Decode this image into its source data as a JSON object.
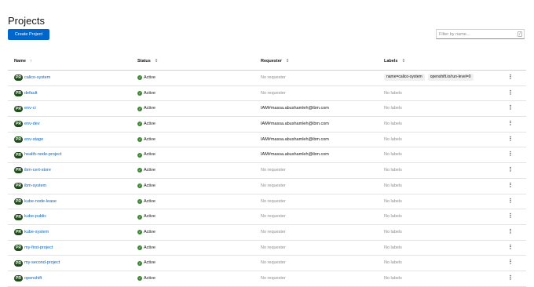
{
  "page": {
    "title": "Projects"
  },
  "toolbar": {
    "create_label": "Create Project",
    "filter_placeholder": "Filter by name...",
    "filter_shortcut": "/"
  },
  "table": {
    "columns": [
      {
        "label": "Name",
        "sorted": true
      },
      {
        "label": "Status",
        "sorted": false
      },
      {
        "label": "Requester",
        "sorted": false
      },
      {
        "label": "Labels",
        "sorted": false
      }
    ],
    "badge": "PR",
    "rows": [
      {
        "name": "calico-system",
        "status": "Active",
        "requester": "No requester",
        "labels": [
          "name=calico-system",
          "openshift.io/run-level=0"
        ]
      },
      {
        "name": "default",
        "status": "Active",
        "requester": "No requester",
        "labels": "No labels"
      },
      {
        "name": "env-ci",
        "status": "Active",
        "requester": "IAM#massa.abushamleh@ibm.com",
        "labels": "No labels"
      },
      {
        "name": "env-dev",
        "status": "Active",
        "requester": "IAM#massa.abushamleh@ibm.com",
        "labels": "No labels"
      },
      {
        "name": "env-stage",
        "status": "Active",
        "requester": "IAM#massa.abushamleh@ibm.com",
        "labels": "No labels"
      },
      {
        "name": "health-node-project",
        "status": "Active",
        "requester": "IAM#massa.abushamleh@ibm.com",
        "labels": "No labels"
      },
      {
        "name": "ibm-cert-store",
        "status": "Active",
        "requester": "No requester",
        "labels": "No labels"
      },
      {
        "name": "ibm-system",
        "status": "Active",
        "requester": "No requester",
        "labels": "No labels"
      },
      {
        "name": "kube-node-lease",
        "status": "Active",
        "requester": "No requester",
        "labels": "No labels"
      },
      {
        "name": "kube-public",
        "status": "Active",
        "requester": "No requester",
        "labels": "No labels"
      },
      {
        "name": "kube-system",
        "status": "Active",
        "requester": "No requester",
        "labels": "No labels"
      },
      {
        "name": "my-first-project",
        "status": "Active",
        "requester": "No requester",
        "labels": "No labels"
      },
      {
        "name": "my-second-project",
        "status": "Active",
        "requester": "No requester",
        "labels": "No labels"
      },
      {
        "name": "openshift",
        "status": "Active",
        "requester": "No requester",
        "labels": "No labels"
      }
    ]
  },
  "icons": {
    "status": "check-circle-icon",
    "actions": "kebab-menu-icon",
    "sort": "sort-icon"
  },
  "colors": {
    "accent": "#0066cc",
    "badge": "#1e4f18",
    "success": "#3e8635"
  }
}
